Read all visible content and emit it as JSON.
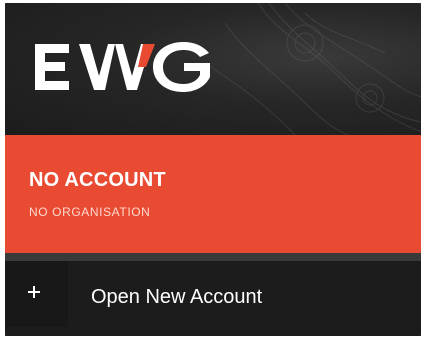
{
  "brand": {
    "logo_text": "EWG",
    "logo_accent_color": "#e84a32",
    "logo_color": "#ffffff"
  },
  "account": {
    "title": "NO ACCOUNT",
    "organisation": "NO ORGANISATION",
    "accent_color": "#e84a32"
  },
  "menu": {
    "items": [
      {
        "icon": "plus-icon",
        "label": "Open New Account"
      }
    ]
  }
}
